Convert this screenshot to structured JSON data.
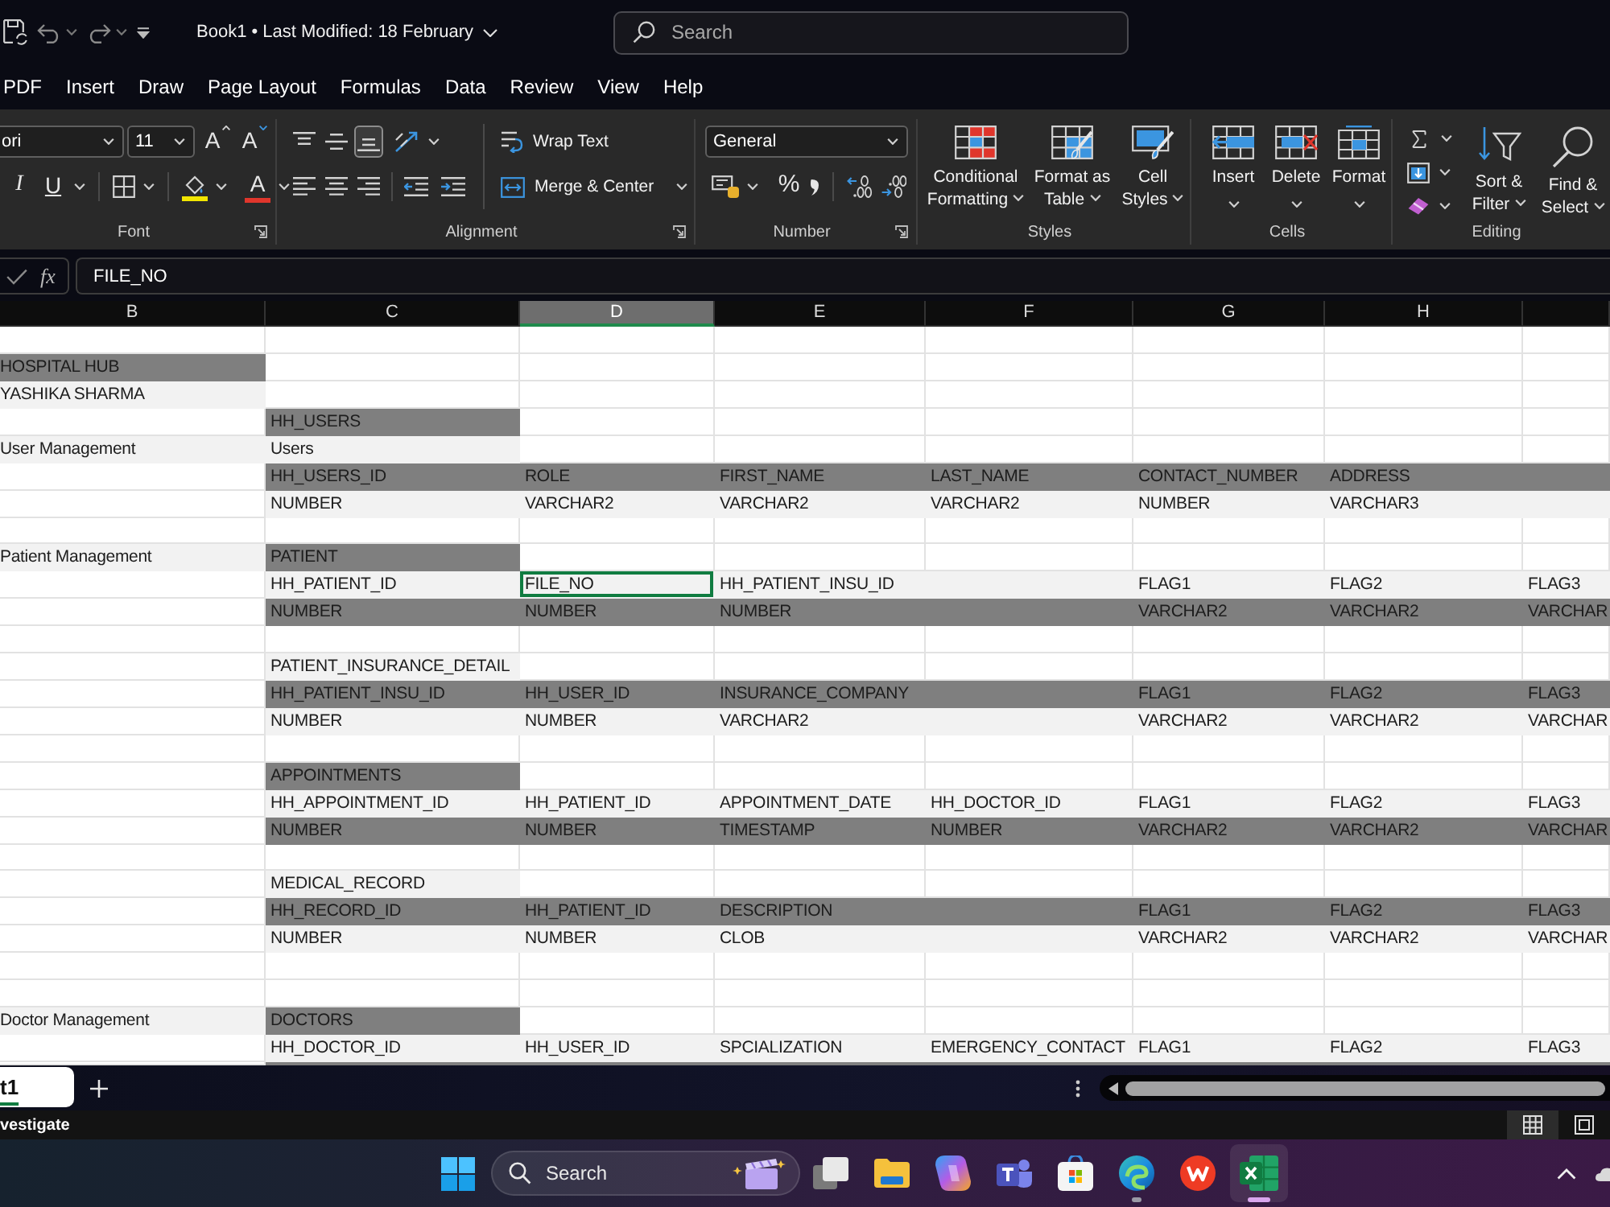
{
  "title_bar": {
    "title": "Book1 • Last Modified: 18 February",
    "search": {
      "placeholder": "Search"
    }
  },
  "menu_tabs": [
    {
      "label": "PDF",
      "selected": false
    },
    {
      "label": "Insert",
      "selected": false
    },
    {
      "label": "Draw",
      "selected": false
    },
    {
      "label": "Page Layout",
      "selected": false
    },
    {
      "label": "Formulas",
      "selected": false
    },
    {
      "label": "Data",
      "selected": false
    },
    {
      "label": "Review",
      "selected": false
    },
    {
      "label": "View",
      "selected": false
    },
    {
      "label": "Help",
      "selected": false
    }
  ],
  "ribbon": {
    "font": {
      "label": "Font",
      "font_name": "ori",
      "font_size": "11",
      "grow_font": "A",
      "shrink_font": "A",
      "italic": "I",
      "underline": "U",
      "font_color": "A"
    },
    "alignment": {
      "label": "Alignment",
      "vertical_align": [
        {
          "kind": "top",
          "selected": false
        },
        {
          "kind": "middle",
          "selected": false
        },
        {
          "kind": "bottom",
          "selected": true
        }
      ],
      "wrap_text": "Wrap Text",
      "merge": "Merge & Center"
    },
    "number": {
      "label": "Number",
      "format": "General",
      "percent": "%"
    },
    "styles": {
      "label": "Styles",
      "buttons": [
        {
          "kind": "conditional",
          "lines": [
            "Conditional",
            "Formatting"
          ]
        },
        {
          "kind": "table",
          "lines": [
            "Format as",
            "Table"
          ]
        },
        {
          "kind": "cell",
          "lines": [
            "Cell",
            "Styles"
          ]
        }
      ]
    },
    "cells": {
      "label": "Cells",
      "buttons": [
        {
          "kind": "insert",
          "label": "Insert"
        },
        {
          "kind": "delete",
          "label": "Delete"
        },
        {
          "kind": "format",
          "label": "Format"
        }
      ]
    },
    "editing": {
      "label": "Editing",
      "buttons": [
        {
          "kind": "sort",
          "lines": [
            "Sort &",
            "Filter"
          ]
        },
        {
          "kind": "find",
          "lines": [
            "Find &",
            "Select"
          ]
        }
      ]
    }
  },
  "formula_bar": {
    "function_label": "fx",
    "value": "FILE_NO"
  },
  "sheet": {
    "columns": [
      {
        "label": "B",
        "selected": false
      },
      {
        "label": "C",
        "selected": false
      },
      {
        "label": "D",
        "selected": true
      },
      {
        "label": "E",
        "selected": false
      },
      {
        "label": "F",
        "selected": false
      },
      {
        "label": "G",
        "selected": false
      },
      {
        "label": "H",
        "selected": false
      },
      {
        "selected": false
      }
    ],
    "rows": [
      {
        "cells": [
          {
            "kind": "plain",
            "selected": false
          },
          {
            "kind": "plain",
            "selected": false
          },
          {
            "kind": "plain",
            "selected": false
          },
          {
            "kind": "plain",
            "selected": false
          },
          {
            "kind": "plain",
            "selected": false
          },
          {
            "kind": "plain",
            "selected": false
          },
          {
            "kind": "plain",
            "selected": false
          },
          {
            "kind": "plain",
            "selected": false
          }
        ]
      },
      {
        "cells": [
          {
            "text": "HOSPITAL HUB",
            "kind": "dark",
            "selected": false
          },
          {
            "kind": "plain",
            "selected": false
          },
          {
            "kind": "plain",
            "selected": false
          },
          {
            "kind": "plain",
            "selected": false
          },
          {
            "kind": "plain",
            "selected": false
          },
          {
            "kind": "plain",
            "selected": false
          },
          {
            "kind": "plain",
            "selected": false
          },
          {
            "kind": "plain",
            "selected": false
          }
        ]
      },
      {
        "cells": [
          {
            "text": "YASHIKA SHARMA",
            "kind": "light",
            "selected": false
          },
          {
            "kind": "plain",
            "selected": false
          },
          {
            "kind": "plain",
            "selected": false
          },
          {
            "kind": "plain",
            "selected": false
          },
          {
            "kind": "plain",
            "selected": false
          },
          {
            "kind": "plain",
            "selected": false
          },
          {
            "kind": "plain",
            "selected": false
          },
          {
            "kind": "plain",
            "selected": false
          }
        ]
      },
      {
        "cells": [
          {
            "kind": "plain",
            "selected": false
          },
          {
            "text": "HH_USERS",
            "kind": "dark",
            "selected": false
          },
          {
            "kind": "plain",
            "selected": false
          },
          {
            "kind": "plain",
            "selected": false
          },
          {
            "kind": "plain",
            "selected": false
          },
          {
            "kind": "plain",
            "selected": false
          },
          {
            "kind": "plain",
            "selected": false
          },
          {
            "kind": "plain",
            "selected": false
          }
        ]
      },
      {
        "cells": [
          {
            "text": "User Management",
            "kind": "light",
            "selected": false
          },
          {
            "text": "Users",
            "kind": "light",
            "selected": false
          },
          {
            "kind": "plain",
            "selected": false
          },
          {
            "kind": "plain",
            "selected": false
          },
          {
            "kind": "plain",
            "selected": false
          },
          {
            "kind": "plain",
            "selected": false
          },
          {
            "kind": "plain",
            "selected": false
          },
          {
            "kind": "plain",
            "selected": false
          }
        ]
      },
      {
        "cells": [
          {
            "kind": "plain",
            "selected": false
          },
          {
            "text": "HH_USERS_ID",
            "kind": "dark",
            "selected": false
          },
          {
            "text": "ROLE",
            "kind": "dark",
            "selected": false
          },
          {
            "text": "FIRST_NAME",
            "kind": "dark",
            "selected": false
          },
          {
            "text": "LAST_NAME",
            "kind": "dark",
            "selected": false
          },
          {
            "text": "CONTACT_NUMBER",
            "kind": "dark",
            "selected": false
          },
          {
            "text": "ADDRESS",
            "kind": "dark",
            "selected": false
          },
          {
            "kind": "dark",
            "selected": false
          }
        ]
      },
      {
        "cells": [
          {
            "kind": "plain",
            "selected": false
          },
          {
            "text": "NUMBER",
            "kind": "light",
            "selected": false
          },
          {
            "text": "VARCHAR2",
            "kind": "light",
            "selected": false
          },
          {
            "text": "VARCHAR2",
            "kind": "light",
            "selected": false
          },
          {
            "text": "VARCHAR2",
            "kind": "light",
            "selected": false
          },
          {
            "text": "NUMBER",
            "kind": "light",
            "selected": false
          },
          {
            "text": "VARCHAR3",
            "kind": "light",
            "selected": false
          },
          {
            "kind": "light",
            "selected": false
          }
        ]
      },
      {
        "cells": [
          {
            "kind": "plain",
            "selected": false
          },
          {
            "kind": "plain",
            "selected": false
          },
          {
            "kind": "plain",
            "selected": false
          },
          {
            "kind": "plain",
            "selected": false
          },
          {
            "kind": "plain",
            "selected": false
          },
          {
            "kind": "plain",
            "selected": false
          },
          {
            "kind": "plain",
            "selected": false
          },
          {
            "kind": "plain",
            "selected": false
          }
        ]
      },
      {
        "cells": [
          {
            "text": "Patient Management",
            "kind": "light",
            "selected": false
          },
          {
            "text": "PATIENT",
            "kind": "dark",
            "selected": false
          },
          {
            "kind": "plain",
            "selected": false
          },
          {
            "kind": "plain",
            "selected": false
          },
          {
            "kind": "plain",
            "selected": false
          },
          {
            "kind": "plain",
            "selected": false
          },
          {
            "kind": "plain",
            "selected": false
          },
          {
            "kind": "plain",
            "selected": false
          }
        ]
      },
      {
        "cells": [
          {
            "kind": "plain",
            "selected": false
          },
          {
            "text": "HH_PATIENT_ID",
            "kind": "light",
            "selected": false
          },
          {
            "text": "FILE_NO",
            "kind": "light",
            "selected": true
          },
          {
            "text": "HH_PATIENT_INSU_ID",
            "kind": "light",
            "selected": false
          },
          {
            "kind": "light",
            "selected": false
          },
          {
            "text": "FLAG1",
            "kind": "light",
            "selected": false
          },
          {
            "text": "FLAG2",
            "kind": "light",
            "selected": false
          },
          {
            "text": "FLAG3",
            "kind": "light",
            "selected": false
          }
        ]
      },
      {
        "cells": [
          {
            "kind": "plain",
            "selected": false
          },
          {
            "text": "NUMBER",
            "kind": "dark",
            "selected": false
          },
          {
            "text": "NUMBER",
            "kind": "dark",
            "selected": false
          },
          {
            "text": "NUMBER",
            "kind": "dark",
            "selected": false
          },
          {
            "kind": "dark",
            "selected": false
          },
          {
            "text": "VARCHAR2",
            "kind": "dark",
            "selected": false
          },
          {
            "text": "VARCHAR2",
            "kind": "dark",
            "selected": false
          },
          {
            "text": "VARCHAR",
            "kind": "dark",
            "selected": false
          }
        ]
      },
      {
        "cells": [
          {
            "kind": "plain",
            "selected": false
          },
          {
            "kind": "plain",
            "selected": false
          },
          {
            "kind": "plain",
            "selected": false
          },
          {
            "kind": "plain",
            "selected": false
          },
          {
            "kind": "plain",
            "selected": false
          },
          {
            "kind": "plain",
            "selected": false
          },
          {
            "kind": "plain",
            "selected": false
          },
          {
            "kind": "plain",
            "selected": false
          }
        ]
      },
      {
        "cells": [
          {
            "kind": "plain",
            "selected": false
          },
          {
            "text": "PATIENT_INSURANCE_DETAIL",
            "kind": "light",
            "selected": false
          },
          {
            "kind": "plain",
            "selected": false
          },
          {
            "kind": "plain",
            "selected": false
          },
          {
            "kind": "plain",
            "selected": false
          },
          {
            "kind": "plain",
            "selected": false
          },
          {
            "kind": "plain",
            "selected": false
          },
          {
            "kind": "plain",
            "selected": false
          }
        ]
      },
      {
        "cells": [
          {
            "kind": "plain",
            "selected": false
          },
          {
            "text": "HH_PATIENT_INSU_ID",
            "kind": "dark",
            "selected": false
          },
          {
            "text": "HH_USER_ID",
            "kind": "dark",
            "selected": false
          },
          {
            "text": "INSURANCE_COMPANY",
            "kind": "dark",
            "selected": false
          },
          {
            "kind": "dark",
            "selected": false
          },
          {
            "text": "FLAG1",
            "kind": "dark",
            "selected": false
          },
          {
            "text": "FLAG2",
            "kind": "dark",
            "selected": false
          },
          {
            "text": "FLAG3",
            "kind": "dark",
            "selected": false
          }
        ]
      },
      {
        "cells": [
          {
            "kind": "plain",
            "selected": false
          },
          {
            "text": "NUMBER",
            "kind": "light",
            "selected": false
          },
          {
            "text": "NUMBER",
            "kind": "light",
            "selected": false
          },
          {
            "text": "VARCHAR2",
            "kind": "light",
            "selected": false
          },
          {
            "kind": "light",
            "selected": false
          },
          {
            "text": "VARCHAR2",
            "kind": "light",
            "selected": false
          },
          {
            "text": "VARCHAR2",
            "kind": "light",
            "selected": false
          },
          {
            "text": "VARCHAR",
            "kind": "light",
            "selected": false
          }
        ]
      },
      {
        "cells": [
          {
            "kind": "plain",
            "selected": false
          },
          {
            "kind": "plain",
            "selected": false
          },
          {
            "kind": "plain",
            "selected": false
          },
          {
            "kind": "plain",
            "selected": false
          },
          {
            "kind": "plain",
            "selected": false
          },
          {
            "kind": "plain",
            "selected": false
          },
          {
            "kind": "plain",
            "selected": false
          },
          {
            "kind": "plain",
            "selected": false
          }
        ]
      },
      {
        "cells": [
          {
            "kind": "plain",
            "selected": false
          },
          {
            "text": "APPOINTMENTS",
            "kind": "dark",
            "selected": false
          },
          {
            "kind": "plain",
            "selected": false
          },
          {
            "kind": "plain",
            "selected": false
          },
          {
            "kind": "plain",
            "selected": false
          },
          {
            "kind": "plain",
            "selected": false
          },
          {
            "kind": "plain",
            "selected": false
          },
          {
            "kind": "plain",
            "selected": false
          }
        ]
      },
      {
        "cells": [
          {
            "kind": "plain",
            "selected": false
          },
          {
            "text": "HH_APPOINTMENT_ID",
            "kind": "light",
            "selected": false
          },
          {
            "text": "HH_PATIENT_ID",
            "kind": "light",
            "selected": false
          },
          {
            "text": "APPOINTMENT_DATE",
            "kind": "light",
            "selected": false
          },
          {
            "text": "HH_DOCTOR_ID",
            "kind": "light",
            "selected": false
          },
          {
            "text": "FLAG1",
            "kind": "light",
            "selected": false
          },
          {
            "text": "FLAG2",
            "kind": "light",
            "selected": false
          },
          {
            "text": "FLAG3",
            "kind": "light",
            "selected": false
          }
        ]
      },
      {
        "cells": [
          {
            "kind": "plain",
            "selected": false
          },
          {
            "text": "NUMBER",
            "kind": "dark",
            "selected": false
          },
          {
            "text": "NUMBER",
            "kind": "dark",
            "selected": false
          },
          {
            "text": "TIMESTAMP",
            "kind": "dark",
            "selected": false
          },
          {
            "text": "NUMBER",
            "kind": "dark",
            "selected": false
          },
          {
            "text": "VARCHAR2",
            "kind": "dark",
            "selected": false
          },
          {
            "text": "VARCHAR2",
            "kind": "dark",
            "selected": false
          },
          {
            "text": "VARCHAR",
            "kind": "dark",
            "selected": false
          }
        ]
      },
      {
        "cells": [
          {
            "kind": "plain",
            "selected": false
          },
          {
            "kind": "plain",
            "selected": false
          },
          {
            "kind": "plain",
            "selected": false
          },
          {
            "kind": "plain",
            "selected": false
          },
          {
            "kind": "plain",
            "selected": false
          },
          {
            "kind": "plain",
            "selected": false
          },
          {
            "kind": "plain",
            "selected": false
          },
          {
            "kind": "plain",
            "selected": false
          }
        ]
      },
      {
        "cells": [
          {
            "kind": "plain",
            "selected": false
          },
          {
            "text": "MEDICAL_RECORD",
            "kind": "light",
            "selected": false
          },
          {
            "kind": "plain",
            "selected": false
          },
          {
            "kind": "plain",
            "selected": false
          },
          {
            "kind": "plain",
            "selected": false
          },
          {
            "kind": "plain",
            "selected": false
          },
          {
            "kind": "plain",
            "selected": false
          },
          {
            "kind": "plain",
            "selected": false
          }
        ]
      },
      {
        "cells": [
          {
            "kind": "plain",
            "selected": false
          },
          {
            "text": "HH_RECORD_ID",
            "kind": "dark",
            "selected": false
          },
          {
            "text": "HH_PATIENT_ID",
            "kind": "dark",
            "selected": false
          },
          {
            "text": "DESCRIPTION",
            "kind": "dark",
            "selected": false
          },
          {
            "kind": "dark",
            "selected": false
          },
          {
            "text": "FLAG1",
            "kind": "dark",
            "selected": false
          },
          {
            "text": "FLAG2",
            "kind": "dark",
            "selected": false
          },
          {
            "text": "FLAG3",
            "kind": "dark",
            "selected": false
          }
        ]
      },
      {
        "cells": [
          {
            "kind": "plain",
            "selected": false
          },
          {
            "text": "NUMBER",
            "kind": "light",
            "selected": false
          },
          {
            "text": "NUMBER",
            "kind": "light",
            "selected": false
          },
          {
            "text": "CLOB",
            "kind": "light",
            "selected": false
          },
          {
            "kind": "light",
            "selected": false
          },
          {
            "text": "VARCHAR2",
            "kind": "light",
            "selected": false
          },
          {
            "text": "VARCHAR2",
            "kind": "light",
            "selected": false
          },
          {
            "text": "VARCHAR",
            "kind": "light",
            "selected": false
          }
        ]
      },
      {
        "cells": [
          {
            "kind": "plain",
            "selected": false
          },
          {
            "kind": "plain",
            "selected": false
          },
          {
            "kind": "plain",
            "selected": false
          },
          {
            "kind": "plain",
            "selected": false
          },
          {
            "kind": "plain",
            "selected": false
          },
          {
            "kind": "plain",
            "selected": false
          },
          {
            "kind": "plain",
            "selected": false
          },
          {
            "kind": "plain",
            "selected": false
          }
        ]
      },
      {
        "cells": [
          {
            "kind": "plain",
            "selected": false
          },
          {
            "kind": "plain",
            "selected": false
          },
          {
            "kind": "plain",
            "selected": false
          },
          {
            "kind": "plain",
            "selected": false
          },
          {
            "kind": "plain",
            "selected": false
          },
          {
            "kind": "plain",
            "selected": false
          },
          {
            "kind": "plain",
            "selected": false
          },
          {
            "kind": "plain",
            "selected": false
          }
        ]
      },
      {
        "cells": [
          {
            "text": "Doctor Management",
            "kind": "light",
            "selected": false
          },
          {
            "text": "DOCTORS",
            "kind": "dark",
            "selected": false
          },
          {
            "kind": "plain",
            "selected": false
          },
          {
            "kind": "plain",
            "selected": false
          },
          {
            "kind": "plain",
            "selected": false
          },
          {
            "kind": "plain",
            "selected": false
          },
          {
            "kind": "plain",
            "selected": false
          },
          {
            "kind": "plain",
            "selected": false
          }
        ]
      },
      {
        "cells": [
          {
            "kind": "plain",
            "selected": false
          },
          {
            "text": "HH_DOCTOR_ID",
            "kind": "light",
            "selected": false
          },
          {
            "text": "HH_USER_ID",
            "kind": "light",
            "selected": false
          },
          {
            "text": "SPCIALIZATION",
            "kind": "light",
            "selected": false
          },
          {
            "text": "EMERGENCY_CONTACT",
            "kind": "light",
            "selected": false
          },
          {
            "text": "FLAG1",
            "kind": "light",
            "selected": false
          },
          {
            "text": "FLAG2",
            "kind": "light",
            "selected": false
          },
          {
            "text": "FLAG3",
            "kind": "light",
            "selected": false
          }
        ]
      },
      {
        "cells": [
          {
            "kind": "plain",
            "selected": false
          },
          {
            "kind": "dark",
            "selected": false
          },
          {
            "kind": "dark",
            "selected": false
          },
          {
            "kind": "dark",
            "selected": false
          },
          {
            "kind": "dark",
            "selected": false
          },
          {
            "kind": "dark",
            "selected": false
          },
          {
            "kind": "dark",
            "selected": false
          },
          {
            "kind": "dark",
            "selected": false
          }
        ]
      }
    ]
  },
  "sheet_tabs": [
    {
      "label": "t1",
      "selected": true
    }
  ],
  "status_bar": {
    "text": "vestigate",
    "views": [
      {
        "kind": "normal",
        "selected": true
      },
      {
        "kind": "page",
        "selected": false
      }
    ]
  },
  "taskbar": {
    "search": {
      "placeholder": "Search"
    },
    "apps": [
      {
        "kind": "taskview",
        "running": false,
        "selected": false
      },
      {
        "kind": "folder",
        "running": false,
        "selected": false
      },
      {
        "kind": "swirl",
        "running": false,
        "selected": false
      },
      {
        "kind": "chat",
        "running": false,
        "selected": false
      },
      {
        "kind": "store",
        "running": false,
        "selected": false
      },
      {
        "kind": "browser",
        "running": true,
        "selected": false
      },
      {
        "kind": "office",
        "running": false,
        "selected": false
      },
      {
        "kind": "spreadsheet",
        "running": true,
        "selected": true
      }
    ]
  }
}
